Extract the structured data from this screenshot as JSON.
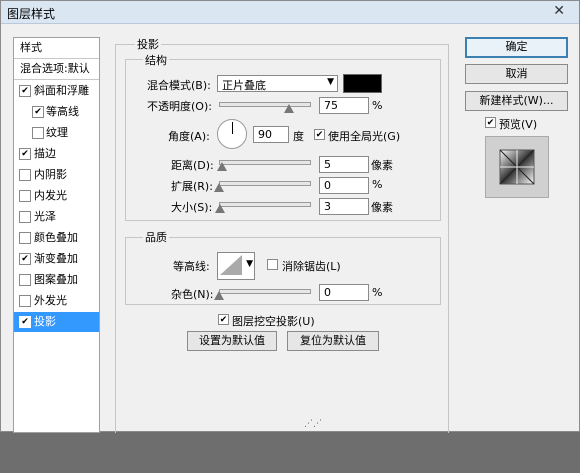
{
  "window": {
    "title": "图层样式",
    "close_glyph": "✕"
  },
  "sidebar": {
    "header": "样式",
    "blend_options": "混合选项:默认",
    "items": [
      {
        "label": "斜面和浮雕",
        "checked": true
      },
      {
        "label": "等高线",
        "checked": true
      },
      {
        "label": "纹理",
        "checked": false
      },
      {
        "label": "描边",
        "checked": true
      },
      {
        "label": "内阴影",
        "checked": false
      },
      {
        "label": "内发光",
        "checked": false
      },
      {
        "label": "光泽",
        "checked": false
      },
      {
        "label": "颜色叠加",
        "checked": false
      },
      {
        "label": "渐变叠加",
        "checked": true
      },
      {
        "label": "图案叠加",
        "checked": false
      },
      {
        "label": "外发光",
        "checked": false
      },
      {
        "label": "投影",
        "checked": true
      }
    ]
  },
  "drop_shadow": {
    "title": "投影",
    "structure": {
      "title": "结构",
      "blend_mode_label": "混合模式(B):",
      "blend_mode_value": "正片叠底",
      "opacity_label": "不透明度(O):",
      "opacity_value": "75",
      "percent": "%",
      "angle_label": "角度(A):",
      "angle_value": "90",
      "degree_unit": "度",
      "global_light_label": "使用全局光(G)",
      "distance_label": "距离(D):",
      "distance_value": "5",
      "pixel_unit": "像素",
      "spread_label": "扩展(R):",
      "spread_value": "0",
      "size_label": "大小(S):",
      "size_value": "3"
    },
    "quality": {
      "title": "品质",
      "contour_label": "等高线:",
      "antialias_label": "消除锯齿(L)",
      "noise_label": "杂色(N):",
      "noise_value": "0"
    },
    "knockout_label": "图层挖空投影(U)",
    "make_default": "设置为默认值",
    "reset_default": "复位为默认值"
  },
  "right": {
    "ok": "确定",
    "cancel": "取消",
    "new_style": "新建样式(W)...",
    "preview_label": "预览(V)"
  },
  "colors": {
    "shadow_color": "#000000",
    "selection": "#3399ff"
  }
}
